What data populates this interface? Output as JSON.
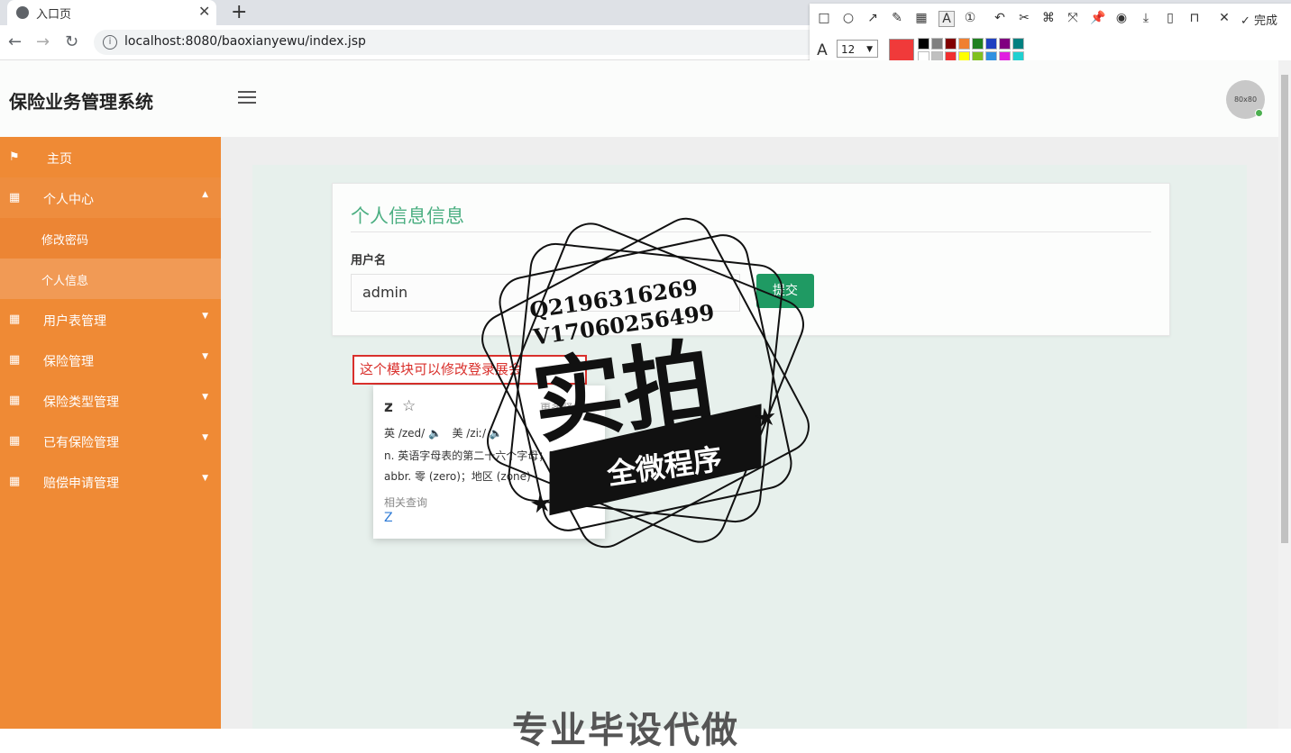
{
  "browser": {
    "tab_title": "入口页",
    "new_tab": "+",
    "url": "localhost:8080/baoxianyewu/index.jsp"
  },
  "toolbar": {
    "done_label": "完成",
    "font_size": "12",
    "current_color": "#f03a3a",
    "palette": [
      "#000000",
      "#808080",
      "#800000",
      "#f08030",
      "#208020",
      "#2040c0",
      "#800080",
      "#008080",
      "#ffffff",
      "#c0c0c0",
      "#f03030",
      "#ffff00",
      "#80c020",
      "#3090e0",
      "#e020e0",
      "#20d0d0"
    ]
  },
  "app": {
    "title": "保险业务管理系统",
    "avatar_text": "80x80"
  },
  "sidebar": {
    "items": [
      {
        "label": "主页",
        "icon": "flag-icon"
      },
      {
        "label": "个人中心",
        "icon": "grid-icon"
      },
      {
        "label": "修改密码"
      },
      {
        "label": "个人信息"
      },
      {
        "label": "用户表管理",
        "icon": "grid-icon"
      },
      {
        "label": "保险管理",
        "icon": "grid-icon"
      },
      {
        "label": "保险类型管理",
        "icon": "grid-icon"
      },
      {
        "label": "已有保险管理",
        "icon": "grid-icon"
      },
      {
        "label": "赔偿申请管理",
        "icon": "grid-icon"
      }
    ]
  },
  "form": {
    "title": "个人信息信息",
    "username_label": "用户名",
    "username_value": "admin",
    "submit_label": "提交"
  },
  "annotation": {
    "text": "这个模块可以修改登录展会"
  },
  "dictionary": {
    "word": "z",
    "more": "更多释义",
    "phonetic_uk": "英 /zed/",
    "phonetic_us": "美 /ziː/",
    "def1": "n. 英语字母表的第二十六个字母；Z字形",
    "def2": "abbr. 零 (zero)；地区 (zone)",
    "related_label": "相关查询",
    "related": "Z"
  },
  "watermark": {
    "line1": "Q2196316269",
    "line2": "V17060256499",
    "big": "实拍",
    "ribbon": "全微程序",
    "bottom": "专业毕设代做"
  }
}
